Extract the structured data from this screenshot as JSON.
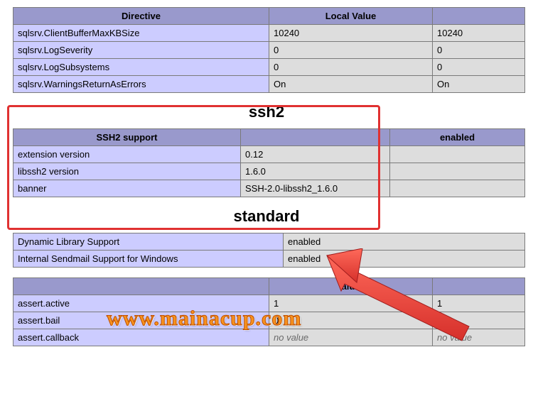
{
  "table1": {
    "headers": [
      "Directive",
      "Local Value",
      ""
    ],
    "cols": [
      360,
      230,
      130
    ],
    "rows": [
      [
        "sqlsrv.ClientBufferMaxKBSize",
        "10240",
        "10240"
      ],
      [
        "sqlsrv.LogSeverity",
        "0",
        "0"
      ],
      [
        "sqlsrv.LogSubsystems",
        "0",
        "0"
      ],
      [
        "sqlsrv.WarningsReturnAsErrors",
        "On",
        "On"
      ]
    ]
  },
  "section_ssh2": {
    "title": "ssh2"
  },
  "table2": {
    "headers": [
      "SSH2 support",
      "",
      "enabled"
    ],
    "cols": [
      320,
      210,
      190
    ],
    "rows": [
      [
        "extension version",
        "0.12",
        ""
      ],
      [
        "libssh2 version",
        "1.6.0",
        ""
      ],
      [
        "banner",
        "SSH-2.0-libssh2_1.6.0",
        ""
      ]
    ]
  },
  "section_standard": {
    "title": "standard"
  },
  "table3": {
    "cols": [
      380,
      340
    ],
    "rows": [
      [
        "Dynamic Library Support",
        "enabled"
      ],
      [
        "Internal Sendmail Support for Windows",
        "enabled"
      ]
    ]
  },
  "table4": {
    "headers": [
      "",
      "alue",
      ""
    ],
    "cols": [
      360,
      230,
      130
    ],
    "rows": [
      [
        "assert.active",
        "1",
        "1"
      ],
      [
        "assert.bail",
        "0",
        "0"
      ],
      [
        "assert.callback",
        "no value",
        "no value"
      ]
    ],
    "novalue_rows": [
      2
    ]
  },
  "watermark": "www.mainacup.com"
}
